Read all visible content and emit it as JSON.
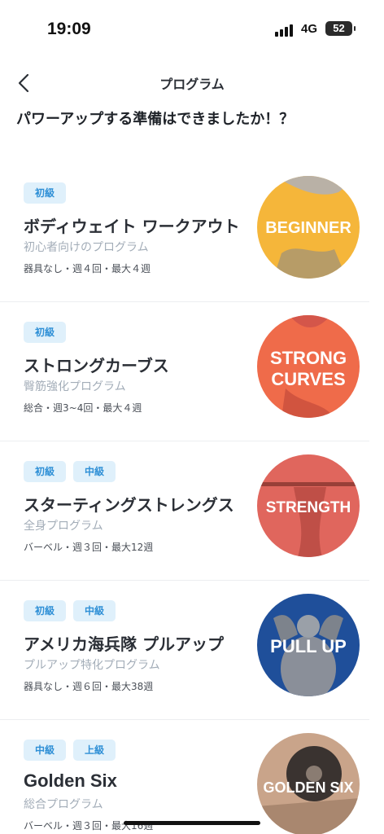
{
  "status_bar": {
    "time": "19:09",
    "network": "4G",
    "battery": "52"
  },
  "nav": {
    "title": "プログラム",
    "back_icon": "chevron-left-icon"
  },
  "headline": "パワーアップする準備はできましたか！？",
  "programs": [
    {
      "tags": [
        "初級"
      ],
      "title": "ボディウェイト ワークアウト",
      "subtitle": "初心者向けのプログラム",
      "meta": "器具なし・週４回・最大４週",
      "thumb_label": "BEGINNER",
      "thumb_color": "#f5b63a"
    },
    {
      "tags": [
        "初級"
      ],
      "title": "ストロングカーブス",
      "subtitle": "臀筋強化プログラム",
      "meta": "総合・週3~4回・最大４週",
      "thumb_label_1": "STRONG",
      "thumb_label_2": "CURVES",
      "thumb_color": "#ef6b4a"
    },
    {
      "tags": [
        "初級",
        "中級"
      ],
      "title": "スターティングストレングス",
      "subtitle": "全身プログラム",
      "meta": "バーベル・週３回・最大12週",
      "thumb_label": "STRENGTH",
      "thumb_color": "#e0665d"
    },
    {
      "tags": [
        "初級",
        "中級"
      ],
      "title": "アメリカ海兵隊 プルアップ",
      "subtitle": "プルアップ特化プログラム",
      "meta": "器具なし・週６回・最大38週",
      "thumb_label": "PULL UP",
      "thumb_color": "#1f4f9a"
    },
    {
      "tags": [
        "中級",
        "上級"
      ],
      "title": "Golden Six",
      "subtitle": "総合プログラム",
      "meta": "バーベル・週３回・最大16週",
      "thumb_label": "GOLDEN SIX",
      "thumb_color": "#c9a48a"
    }
  ]
}
